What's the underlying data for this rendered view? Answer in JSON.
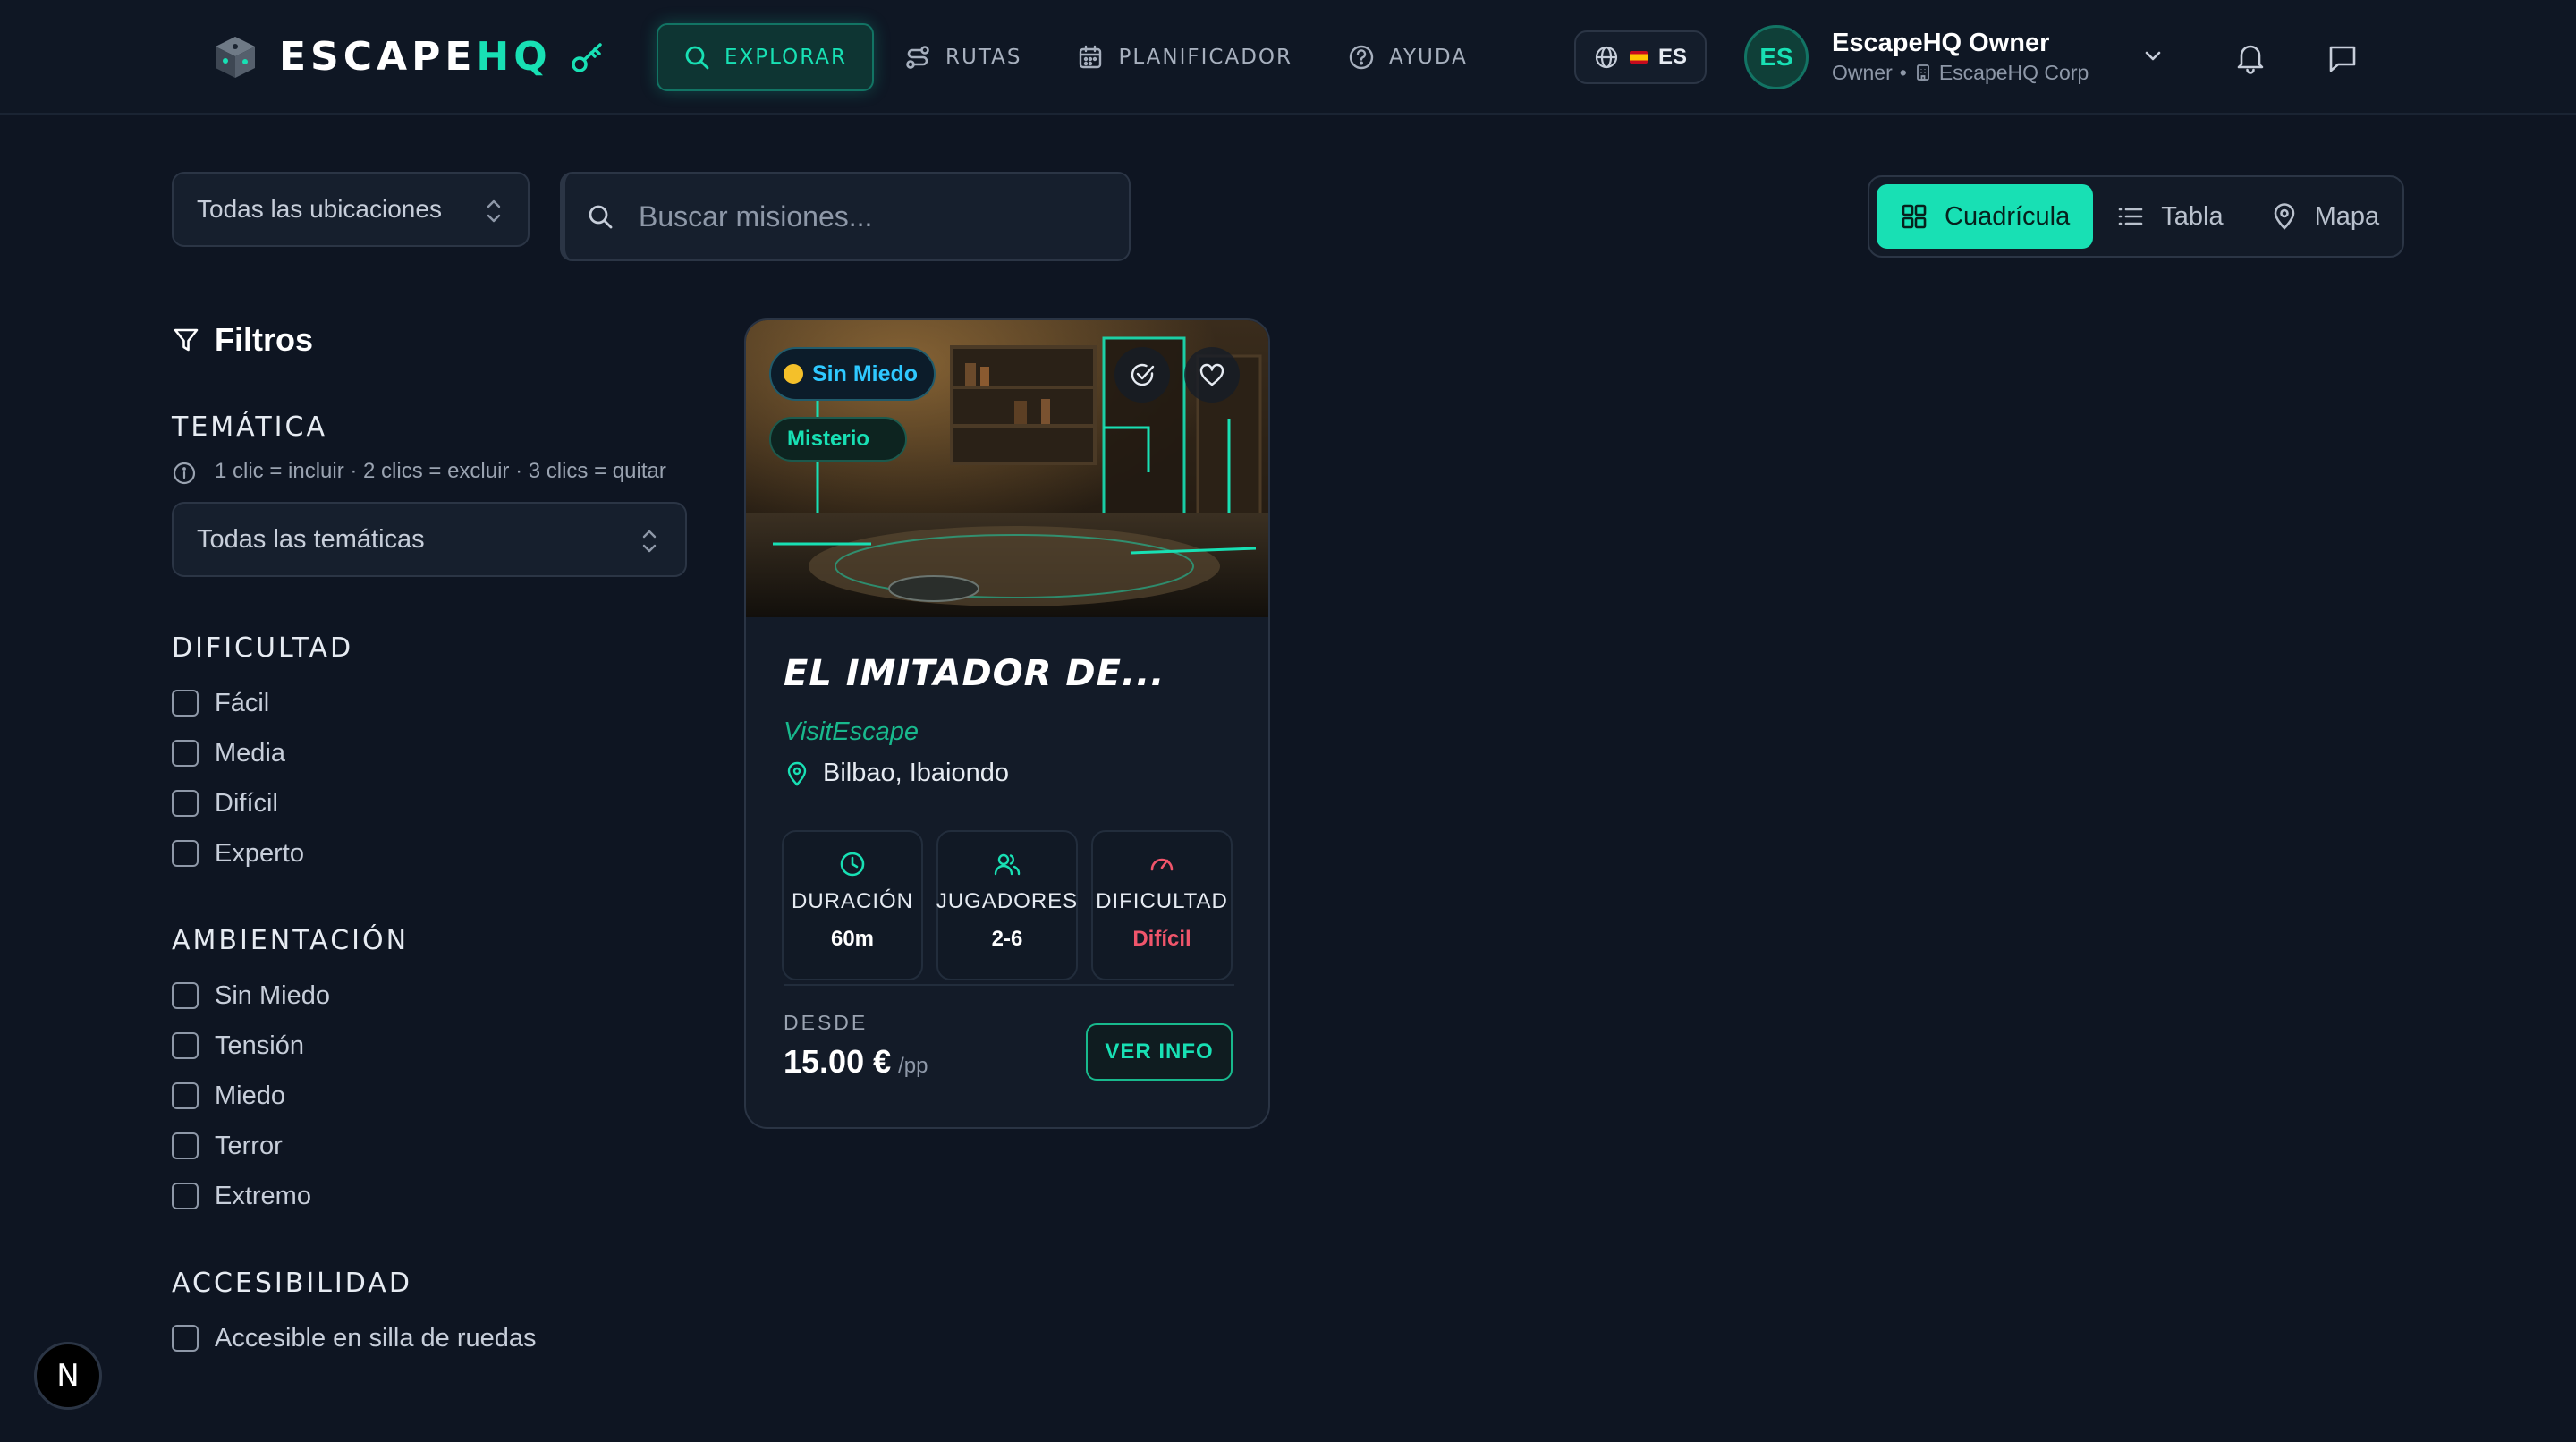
{
  "brand": {
    "name_a": "ESCAPE",
    "name_b": "HQ"
  },
  "nav": {
    "items": [
      {
        "label": "EXPLORAR",
        "icon": "search-icon",
        "active": true
      },
      {
        "label": "RUTAS",
        "icon": "route-icon",
        "active": false
      },
      {
        "label": "PLANIFICADOR",
        "icon": "calendar-icon",
        "active": false
      },
      {
        "label": "AYUDA",
        "icon": "help-icon",
        "active": false
      }
    ]
  },
  "header": {
    "language": "ES",
    "user": {
      "initials": "ES",
      "name": "EscapeHQ Owner",
      "role": "Owner",
      "separator": "•",
      "company": "EscapeHQ Corp"
    }
  },
  "toolbar": {
    "location_select": "Todas las ubicaciones",
    "search_placeholder": "Buscar misiones...",
    "views": [
      {
        "label": "Cuadrícula",
        "icon": "grid-icon",
        "active": true
      },
      {
        "label": "Tabla",
        "icon": "list-icon",
        "active": false
      },
      {
        "label": "Mapa",
        "icon": "map-pin-icon",
        "active": false
      }
    ]
  },
  "filters": {
    "title": "Filtros",
    "theme": {
      "title": "TEMÁTICA",
      "hint": "1 clic = incluir · 2 clics = excluir · 3 clics = quitar",
      "select": "Todas las temáticas"
    },
    "difficulty": {
      "title": "DIFICULTAD",
      "options": [
        "Fácil",
        "Media",
        "Difícil",
        "Experto"
      ]
    },
    "ambience": {
      "title": "AMBIENTACIÓN",
      "options": [
        "Sin Miedo",
        "Tensión",
        "Miedo",
        "Terror",
        "Extremo"
      ]
    },
    "accessibility": {
      "title": "ACCESIBILIDAD",
      "options": [
        "Accesible en silla de ruedas"
      ]
    }
  },
  "card": {
    "mood_badge": "Sin Miedo",
    "theme_badge": "Misterio",
    "title": "EL IMITADOR DE...",
    "company": "VisitEscape",
    "location": "Bilbao, Ibaiondo",
    "stats": [
      {
        "label": "DURACIÓN",
        "value": "60m",
        "icon": "clock-icon"
      },
      {
        "label": "JUGADORES",
        "value": "2-6",
        "icon": "users-icon"
      },
      {
        "label": "DIFICULTAD",
        "value": "Difícil",
        "icon": "gauge-icon"
      }
    ],
    "from_label": "DESDE",
    "price": "15.00 €",
    "price_unit": "/pp",
    "cta": "VER INFO"
  },
  "floating": {
    "badge": "N"
  },
  "colors": {
    "background": "#0e1522",
    "accent": "#18e0b4",
    "difficulty_hard": "#f0556b",
    "mood_badge_text": "#2ec8ff"
  }
}
